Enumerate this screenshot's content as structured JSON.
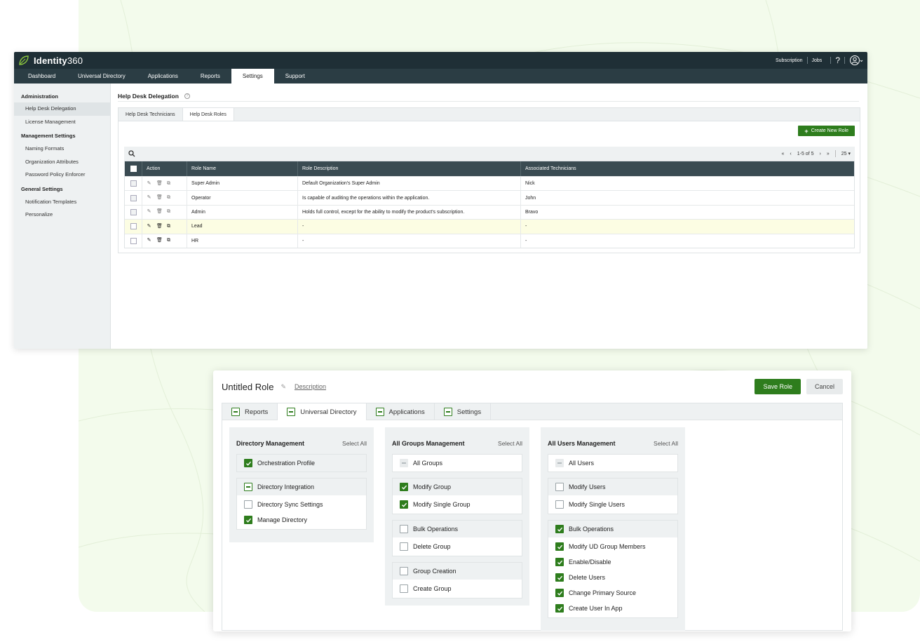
{
  "colors": {
    "brand_green": "#2e7d1d",
    "topbar": "#1f2f36",
    "navbar": "#2b3d44",
    "table_head": "#3a4b52",
    "bg": "#f3fbec"
  },
  "app": {
    "name_bold": "Identity",
    "name_light": "360",
    "logo_icon": "leaf-icon",
    "top_links": [
      "Subscription",
      "Jobs"
    ],
    "help": "?",
    "user_icon": "user-icon"
  },
  "nav": [
    "Dashboard",
    "Universal Directory",
    "Applications",
    "Reports",
    "Settings",
    "Support"
  ],
  "sidebar": {
    "sections": [
      {
        "title": "Administration",
        "items": [
          "Help Desk Delegation",
          "License Management"
        ]
      },
      {
        "title": "Management Settings",
        "items": [
          "Naming Formats",
          "Organization Attributes",
          "Password Policy Enforcer"
        ]
      },
      {
        "title": "General Settings",
        "items": [
          "Notification Templates",
          "Personalize"
        ]
      }
    ]
  },
  "main": {
    "title": "Help Desk Delegation",
    "tabs": [
      "Help Desk Technicians",
      "Help Desk Roles"
    ],
    "create_button": "Create New Role",
    "pager": {
      "first": "«",
      "prev": "‹",
      "range": "1-5 of 5",
      "next": "›",
      "last": "»",
      "per_page": "25"
    },
    "columns": [
      "Action",
      "Role Name",
      "Role Description",
      "Associated Technicians"
    ],
    "rows": [
      {
        "name": "Super Admin",
        "description": "Default Organization's Super Admin",
        "technicians": "Nick"
      },
      {
        "name": "Operator",
        "description": "Is capable of auditing the operations within the application.",
        "technicians": "John"
      },
      {
        "name": "Admin",
        "description": "Holds full control, except for the ability to modify the product's subscription.",
        "technicians": "Bravo"
      },
      {
        "name": "Lead",
        "description": "-",
        "technicians": "-"
      },
      {
        "name": "HR",
        "description": "-",
        "technicians": "-"
      }
    ]
  },
  "role_editor": {
    "title": "Untitled Role",
    "description_link": "Description",
    "save": "Save Role",
    "cancel": "Cancel",
    "tabs": [
      "Reports",
      "Universal Directory",
      "Applications",
      "Settings"
    ],
    "select_all": "Select All",
    "columns": [
      {
        "title": "Directory Management",
        "groups": [
          {
            "items": [
              {
                "label": "Orchestration Profile",
                "state": "checked"
              }
            ]
          },
          {
            "head": {
              "label": "Directory Integration",
              "state": "partial"
            },
            "items": [
              {
                "label": "Directory Sync Settings",
                "state": "unchecked"
              },
              {
                "label": "Manage Directory",
                "state": "checked"
              }
            ]
          }
        ]
      },
      {
        "title": "All Groups Management",
        "groups": [
          {
            "items": [
              {
                "label": "All Groups",
                "state": "disabled"
              }
            ]
          },
          {
            "head": {
              "label": "Modify Group",
              "state": "checked"
            },
            "items": [
              {
                "label": "Modify Single Group",
                "state": "checked"
              }
            ]
          },
          {
            "head": {
              "label": "Bulk Operations",
              "state": "unchecked"
            },
            "items": [
              {
                "label": "Delete Group",
                "state": "unchecked"
              }
            ]
          },
          {
            "head": {
              "label": "Group Creation",
              "state": "unchecked"
            },
            "items": [
              {
                "label": "Create Group",
                "state": "unchecked"
              }
            ]
          }
        ]
      },
      {
        "title": "All Users Management",
        "groups": [
          {
            "items": [
              {
                "label": "All Users",
                "state": "disabled"
              }
            ]
          },
          {
            "head": {
              "label": "Modify Users",
              "state": "unchecked"
            },
            "items": [
              {
                "label": "Modify Single Users",
                "state": "unchecked"
              }
            ]
          },
          {
            "head": {
              "label": "Bulk Operations",
              "state": "checked"
            },
            "items": [
              {
                "label": "Modify UD Group Members",
                "state": "checked"
              },
              {
                "label": "Enable/Disable",
                "state": "checked"
              },
              {
                "label": "Delete Users",
                "state": "checked"
              },
              {
                "label": "Change Primary Source",
                "state": "checked"
              },
              {
                "label": "Create User In App",
                "state": "checked"
              }
            ]
          }
        ]
      }
    ]
  }
}
